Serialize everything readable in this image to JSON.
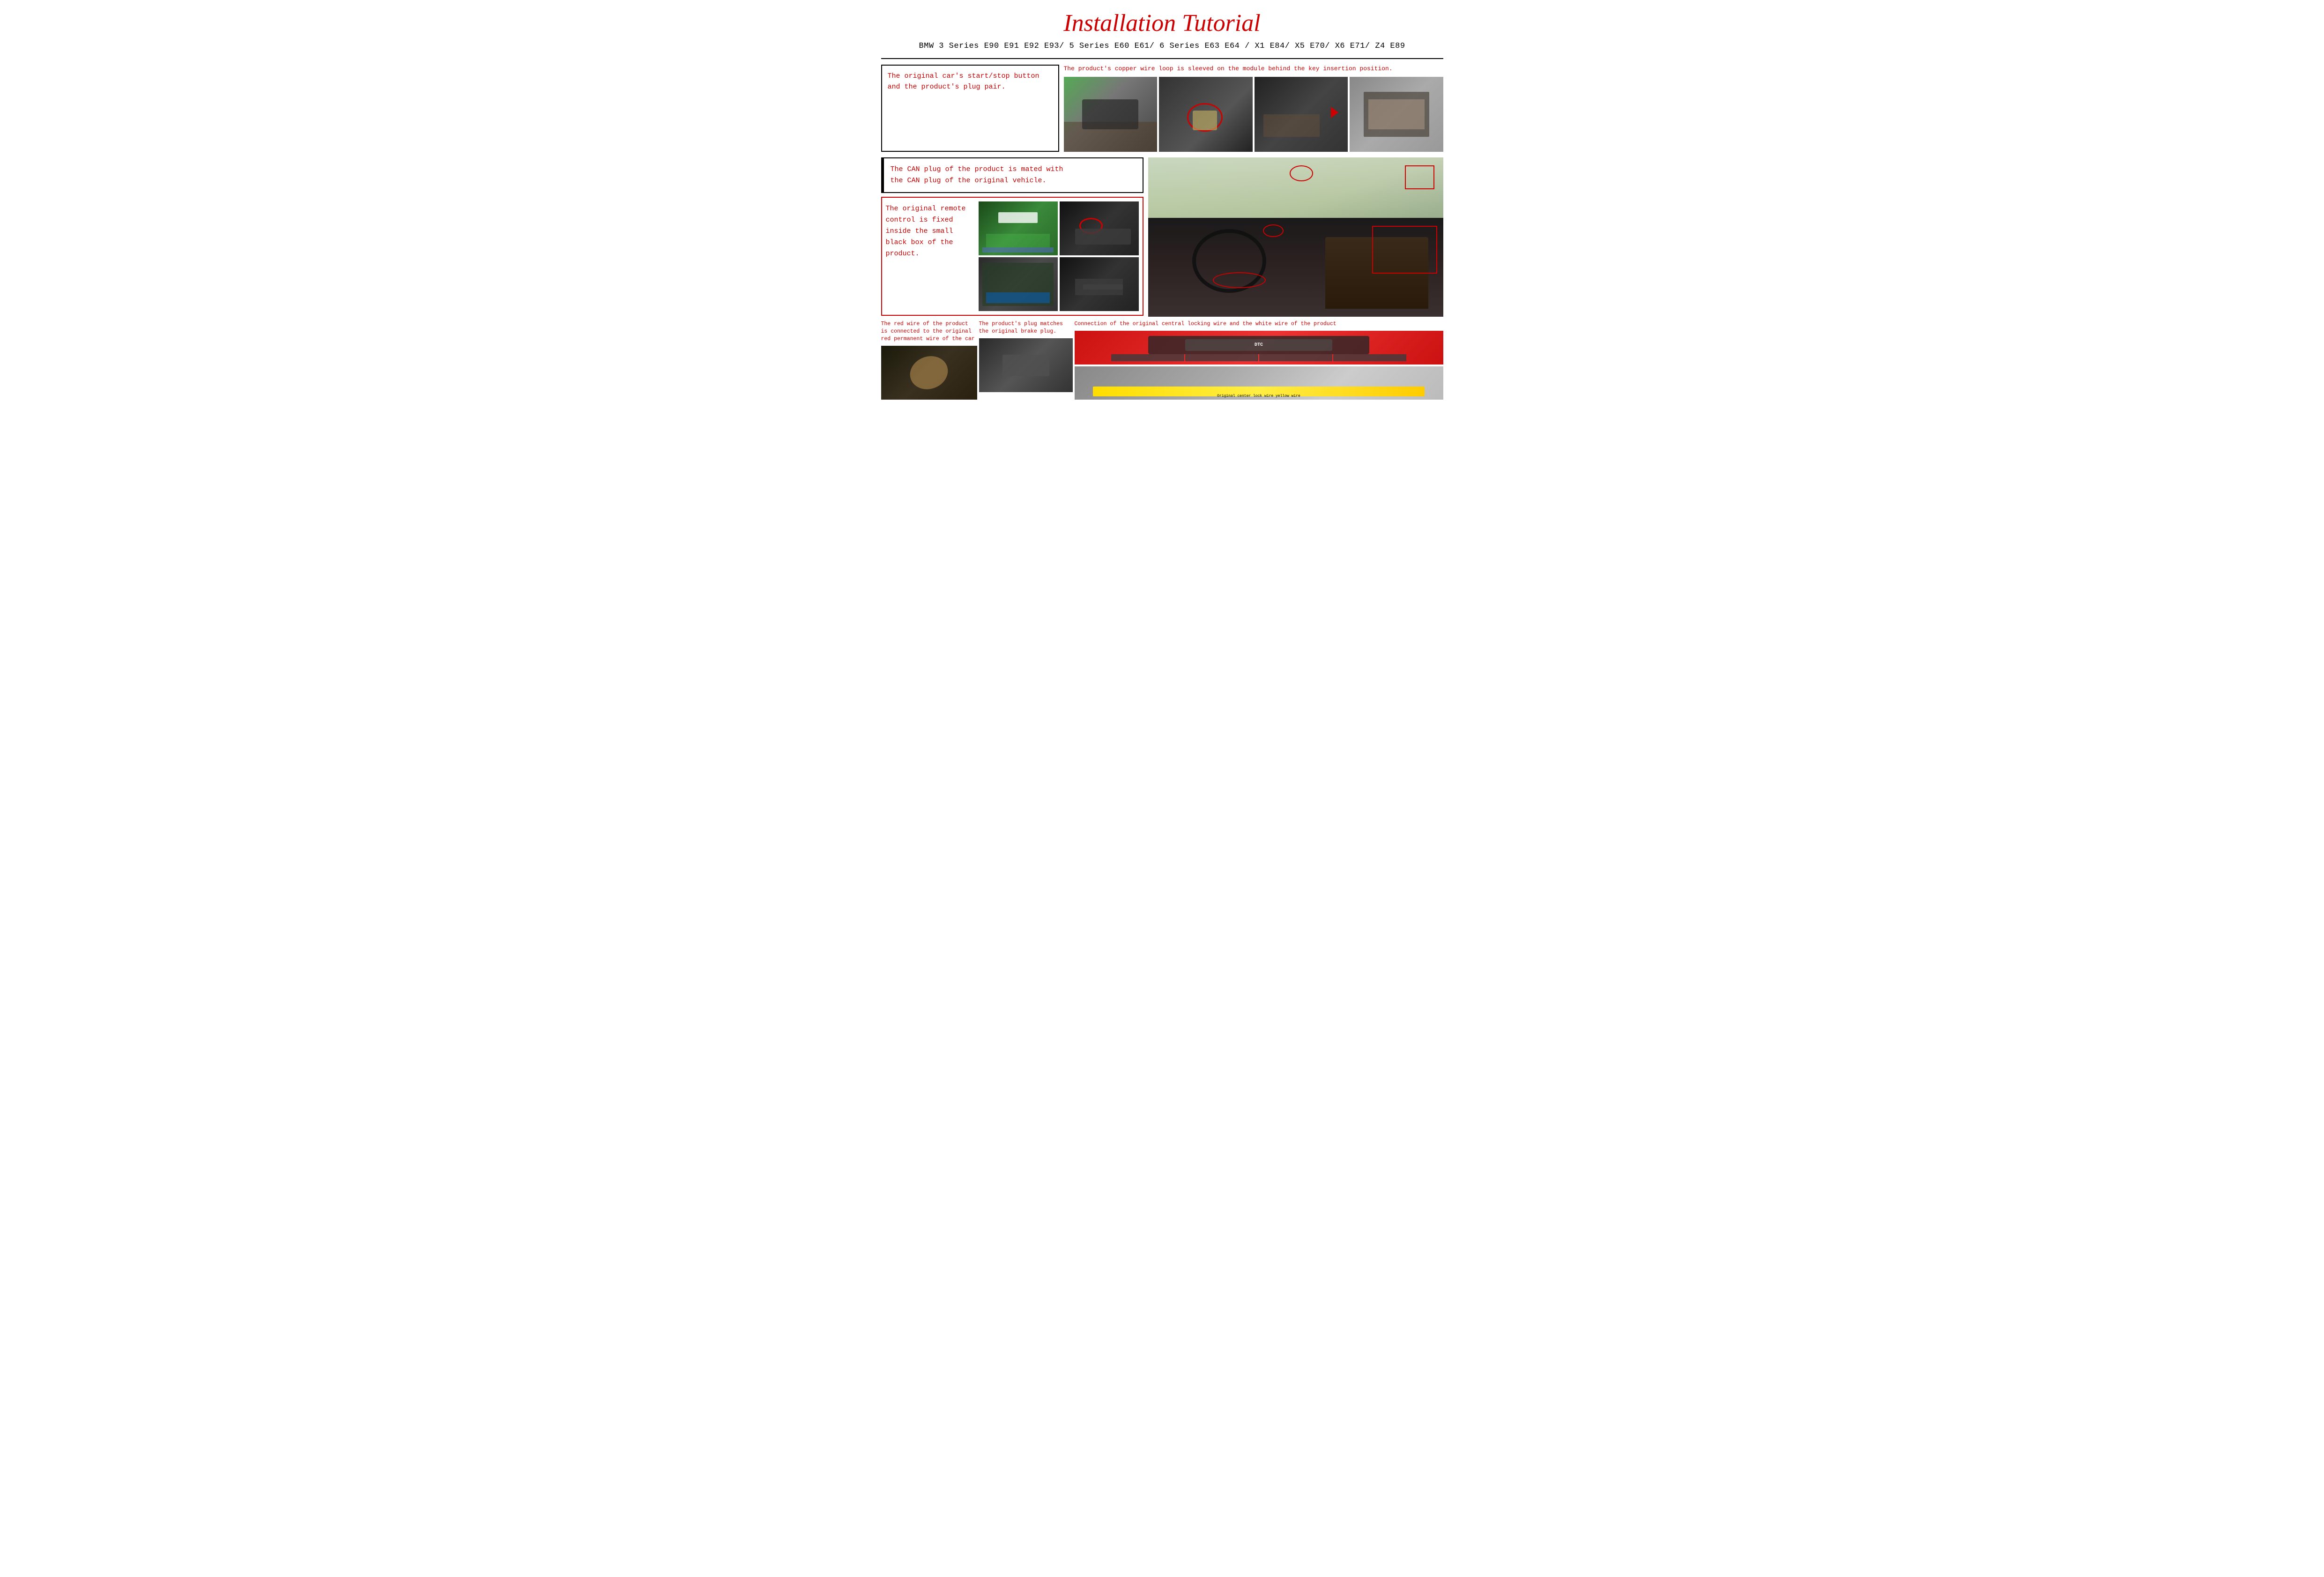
{
  "page": {
    "title": "Installation Tutorial",
    "subtitle": "BMW 3 Series E90 E91 E92 E93/ 5 Series E60 E61/ 6 Series E63 E64 / X1 E84/ X5 E70/ X6 E71/  Z4 E89"
  },
  "top_section": {
    "left_desc": "The original car's start/stop button and the product's plug pair.",
    "right_desc": "The product's copper wire loop is sleeved on the module behind the key insertion position."
  },
  "middle_section": {
    "can_plug_desc": "The CAN plug of the product is mated with\nthe CAN plug of the original vehicle.",
    "remote_desc": "The original remote control is fixed inside the small black box of the product."
  },
  "bottom_section": {
    "col1_desc": "The red wire of the product is connected to the original red permanent wire of the car",
    "col2_desc": "The product's plug matches the original brake plug.",
    "col3_desc": "Connection of the original central locking wire and the white wire of the product",
    "col3_sub_label": "Original center lock wire yellow wire"
  }
}
